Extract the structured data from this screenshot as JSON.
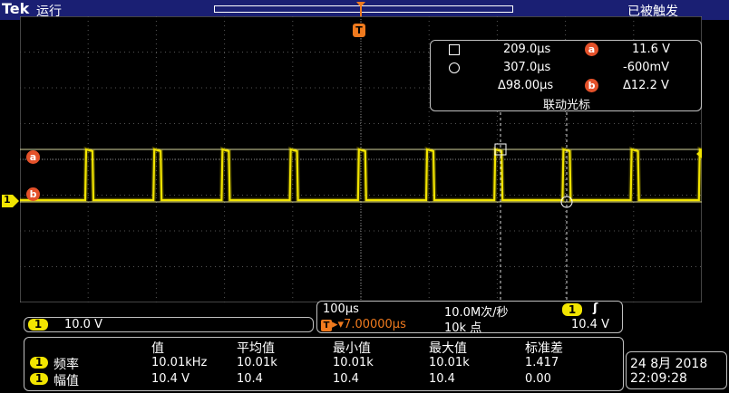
{
  "topbar": {
    "logo": "Tek",
    "run_status": "运行",
    "trigger_status": "已被触发"
  },
  "markers": {
    "trigger_t": "T",
    "ref_a": "a",
    "ref_b": "b",
    "ch1": "1"
  },
  "cursor_readout": {
    "row1_time": "209.0µs",
    "row1_marker": "a",
    "row1_volt": "11.6 V",
    "row2_time": "307.0µs",
    "row2_volt": "-600mV",
    "delta_time": "Δ98.00µs",
    "delta_marker": "b",
    "delta_volt": "Δ12.2 V",
    "mode": "联动光标"
  },
  "horizontal": {
    "timebase": "100µs",
    "sample_rate": "10.0M次/秒",
    "trig_ch": "1",
    "trig_slope": "ʃ",
    "trig_prefix": "T",
    "trig_position": "▸▾7.00000µs",
    "record_length": "10k 点",
    "trig_level": "10.4 V"
  },
  "ch1_scale": {
    "ch": "1",
    "value": "10.0 V"
  },
  "measurements": {
    "headers": [
      "值",
      "平均值",
      "最小值",
      "最大值",
      "标准差"
    ],
    "rows": [
      {
        "ch": "1",
        "name": "频率",
        "values": [
          "10.01kHz",
          "10.01k",
          "10.01k",
          "10.01k",
          "1.417"
        ]
      },
      {
        "ch": "1",
        "name": "幅值",
        "values": [
          "10.4 V",
          "10.4",
          "10.4",
          "10.4",
          "0.00"
        ]
      }
    ]
  },
  "datetime": {
    "date": "24 8月 2018",
    "time": "22:09:28"
  },
  "colors": {
    "trace": "#f2e500",
    "marker": "#e4512a",
    "trigger": "#f07a1e",
    "topbar": "#1a1f73"
  }
}
